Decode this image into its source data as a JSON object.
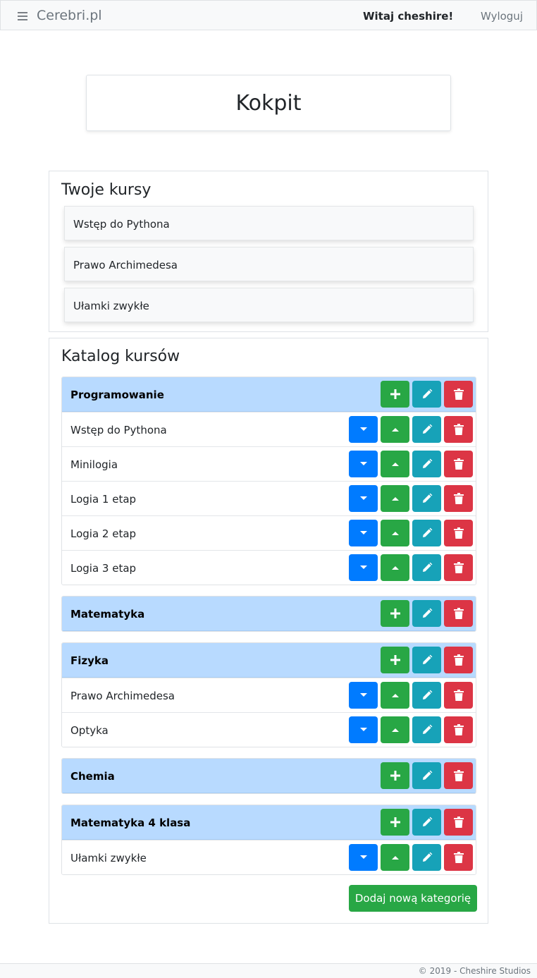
{
  "navbar": {
    "brand": "Cerebri.pl",
    "greeting": "Witaj cheshire!",
    "logout": "Wyloguj"
  },
  "page_title": "Kokpit",
  "my_courses": {
    "title": "Twoje kursy",
    "items": [
      "Wstęp do Pythona",
      "Prawo Archimedesa",
      "Ułamki zwykłe"
    ]
  },
  "catalog": {
    "title": "Katalog kursów",
    "categories": [
      {
        "name": "Programowanie",
        "courses": [
          "Wstęp do Pythona",
          "Minilogia",
          "Logia 1 etap",
          "Logia 2 etap",
          "Logia 3 etap"
        ]
      },
      {
        "name": "Matematyka",
        "courses": []
      },
      {
        "name": "Fizyka",
        "courses": [
          "Prawo Archimedesa",
          "Optyka"
        ]
      },
      {
        "name": "Chemia",
        "courses": []
      },
      {
        "name": "Matematyka 4 klasa",
        "courses": [
          "Ułamki zwykłe"
        ]
      }
    ],
    "add_category_label": "Dodaj nową kategorię"
  },
  "footer": "© 2019 - Cheshire Studios",
  "colors": {
    "header_bg": "#b8daff",
    "blue": "#007bff",
    "green": "#28a745",
    "teal": "#17a2b8",
    "red": "#dc3545"
  },
  "icons": {
    "move_down": "caret-down-icon",
    "move_up": "caret-up-icon",
    "add": "plus-icon",
    "edit": "pencil-icon",
    "delete": "trash-icon",
    "menu": "hamburger-icon"
  }
}
